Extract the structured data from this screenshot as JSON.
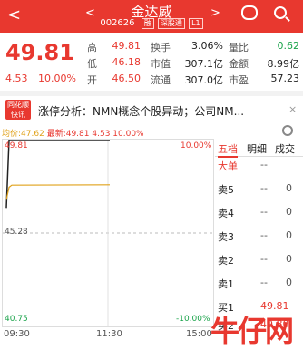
{
  "header": {
    "back": "<",
    "prev": "<",
    "next": ">",
    "title": "金达威",
    "code": "002626",
    "tags": [
      "融",
      "深股通",
      "L1"
    ]
  },
  "quote": {
    "price": "49.81",
    "change": "4.53",
    "change_pct": "10.00%",
    "stats": [
      {
        "label": "高",
        "value": "49.81",
        "color": "red"
      },
      {
        "label": "换手",
        "value": "3.06%",
        "color": "dark"
      },
      {
        "label": "量比",
        "value": "0.62",
        "color": "green"
      },
      {
        "label": "低",
        "value": "46.18",
        "color": "red"
      },
      {
        "label": "市值",
        "value": "307.1亿",
        "color": "dark"
      },
      {
        "label": "金额",
        "value": "8.99亿",
        "color": "dark"
      },
      {
        "label": "开",
        "value": "46.50",
        "color": "red"
      },
      {
        "label": "流通",
        "value": "307.0亿",
        "color": "dark"
      },
      {
        "label": "市盈",
        "value": "57.23",
        "color": "dark"
      }
    ]
  },
  "news": {
    "logo_top": "同花顺",
    "logo_bottom": "快讯",
    "text": "涨停分析：NMN概念个股异动；公司NM...",
    "close": "×"
  },
  "chart_info": {
    "avg_label": "均价:47.62",
    "latest_label": "最新:49.81",
    "change": "4.53",
    "pct": "10.00%"
  },
  "chart_data": {
    "type": "line",
    "y_labels": {
      "top": "49.81",
      "mid": "45.28",
      "bottom": "40.75"
    },
    "pct_labels": {
      "top": "10.00%",
      "bottom": "-10.00%"
    },
    "x_labels": [
      "09:30",
      "11:30",
      "15:00"
    ],
    "ylim": [
      40.75,
      49.81
    ],
    "series": [
      {
        "name": "价格",
        "values": [
          46.5,
          49.81,
          49.81,
          49.81
        ],
        "color": "#222222"
      },
      {
        "name": "均价",
        "values": [
          46.9,
          47.5,
          47.6,
          47.62
        ],
        "color": "#e0a21b"
      }
    ]
  },
  "panel": {
    "tabs": [
      "五档",
      "明细",
      "成交"
    ],
    "rows": [
      {
        "label": "大单",
        "value": "--",
        "num": ""
      },
      {
        "label": "卖5",
        "value": "--",
        "num": "0"
      },
      {
        "label": "卖4",
        "value": "--",
        "num": "0"
      },
      {
        "label": "卖3",
        "value": "--",
        "num": "0"
      },
      {
        "label": "卖2",
        "value": "--",
        "num": "0"
      },
      {
        "label": "卖1",
        "value": "--",
        "num": "0"
      },
      {
        "label": "买1",
        "value": "49.81",
        "num": ""
      },
      {
        "label": "买2",
        "value": "49.80",
        "num": ""
      }
    ]
  },
  "watermark": "牛仔网"
}
